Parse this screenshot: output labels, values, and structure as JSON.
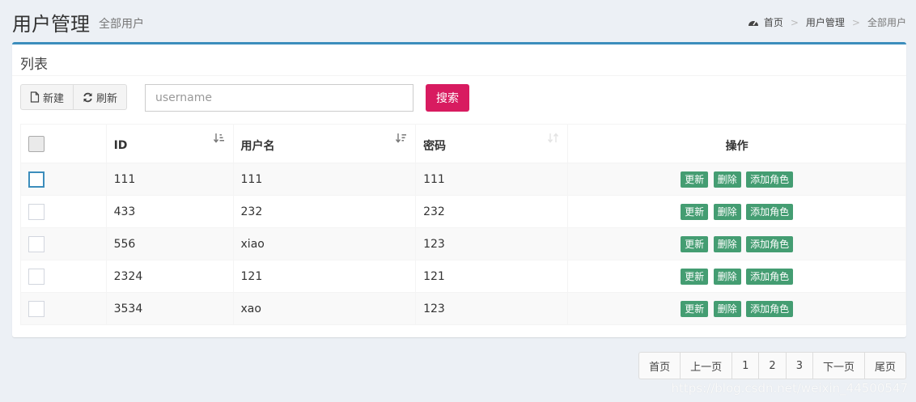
{
  "header": {
    "title": "用户管理",
    "subtitle": "全部用户"
  },
  "breadcrumb": [
    "首页",
    "用户管理",
    "全部用户"
  ],
  "box": {
    "title": "列表"
  },
  "toolbar": {
    "new_label": "新建",
    "refresh_label": "刷新"
  },
  "search": {
    "placeholder": "username",
    "value": "",
    "button_label": "搜索"
  },
  "table": {
    "headers": [
      "ID",
      "用户名",
      "密码",
      "操作"
    ],
    "rows": [
      {
        "id": "111",
        "username": "111",
        "password": "111"
      },
      {
        "id": "433",
        "username": "232",
        "password": "232"
      },
      {
        "id": "556",
        "username": "xiao",
        "password": "123"
      },
      {
        "id": "2324",
        "username": "121",
        "password": "121"
      },
      {
        "id": "3534",
        "username": "xao",
        "password": "123"
      }
    ],
    "actions": {
      "update": "更新",
      "delete": "删除",
      "add_role": "添加角色"
    }
  },
  "pagination": [
    "首页",
    "上一页",
    "1",
    "2",
    "3",
    "下一页",
    "尾页"
  ],
  "watermark": "https://blog.csdn.net/weixin_44500547",
  "colors": {
    "primary": "#3c8dbc",
    "search_button": "#d81b60",
    "action_button": "#449d72",
    "background": "#ecf0f5"
  }
}
